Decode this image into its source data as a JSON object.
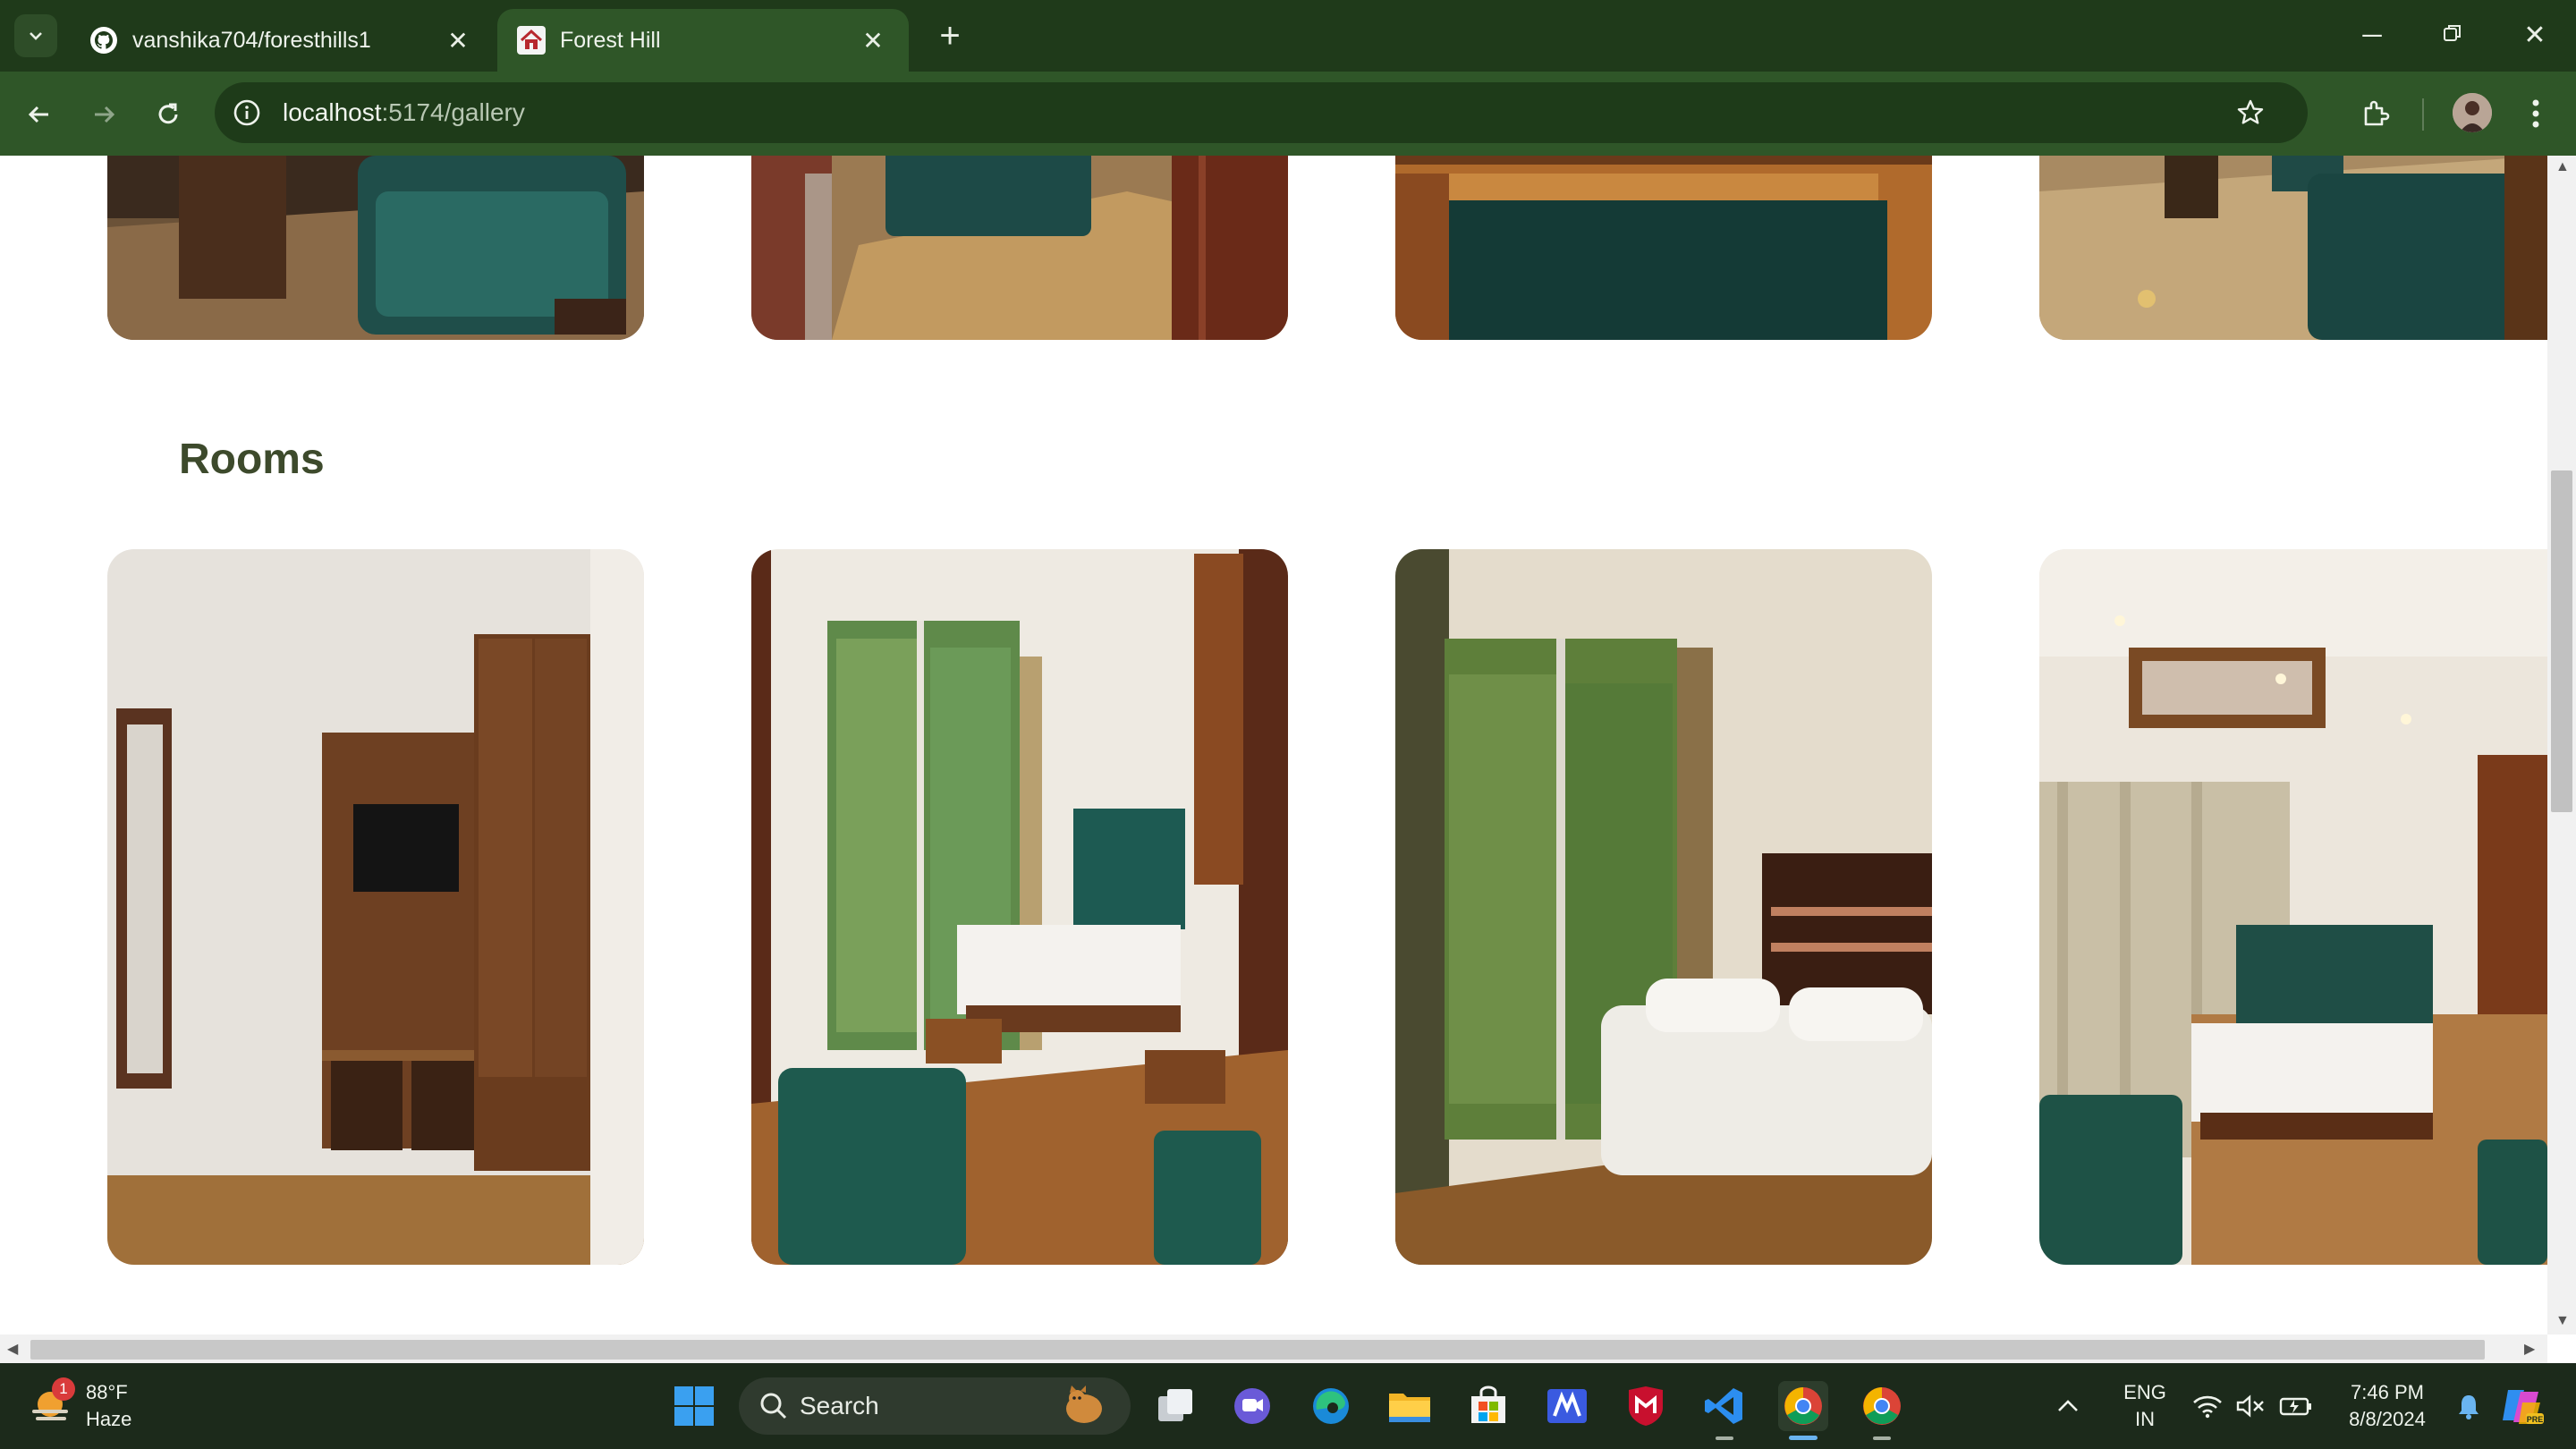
{
  "browser": {
    "tabs": [
      {
        "title": "vanshika704/foresthills1",
        "icon": "github-icon",
        "active": false
      },
      {
        "title": "Forest Hill",
        "icon": "house-icon",
        "active": true
      }
    ],
    "url_host": "localhost",
    "url_rest": ":5174/gallery"
  },
  "gallery": {
    "section_title": "Rooms"
  },
  "taskbar": {
    "weather_temp": "88°F",
    "weather_desc": "Haze",
    "weather_badge": "1",
    "search_label": "Search",
    "lang_line1": "ENG",
    "lang_line2": "IN",
    "time": "7:46 PM",
    "date": "8/8/2024"
  },
  "colors": {
    "chrome_dark": "#1f3a1a",
    "chrome_toolbar": "#2f5628",
    "heading": "#3d4a2c"
  }
}
